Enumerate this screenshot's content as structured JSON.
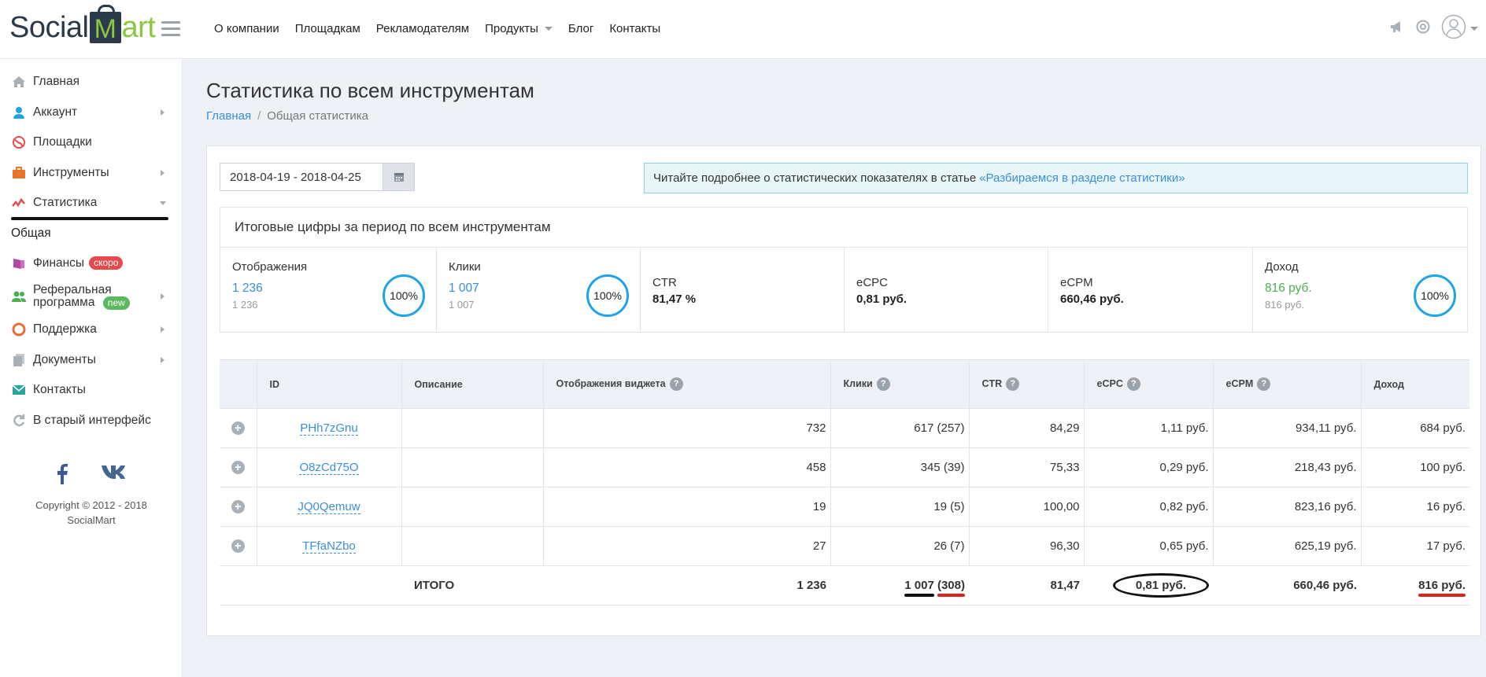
{
  "logo": {
    "part1": "Social",
    "bag": "M",
    "part2": "art"
  },
  "topnav": {
    "about": "О компании",
    "platforms": "Площадкам",
    "advertisers": "Рекламодателям",
    "products": "Продукты",
    "blog": "Блог",
    "contacts": "Контакты"
  },
  "sidebar": {
    "items": [
      {
        "label": "Главная"
      },
      {
        "label": "Аккаунт"
      },
      {
        "label": "Площадки"
      },
      {
        "label": "Инструменты"
      },
      {
        "label": "Статистика"
      },
      {
        "label": "Общая"
      },
      {
        "label": "Финансы",
        "badge": "скоро"
      },
      {
        "label": "Реферальная",
        "label2": "программа",
        "badge": "new"
      },
      {
        "label": "Поддержка"
      },
      {
        "label": "Документы"
      },
      {
        "label": "Контакты"
      },
      {
        "label": "В старый интерфейс"
      }
    ],
    "copyright1": "Copyright © 2012 - 2018",
    "copyright2": "SocialMart"
  },
  "page": {
    "title": "Статистика по всем инструментам",
    "crumb_home": "Главная",
    "crumb_sep": "/",
    "crumb_current": "Общая статистика"
  },
  "filter": {
    "date_range": "2018-04-19 - 2018-04-25"
  },
  "info": {
    "text": "Читайте подробнее о статистических показателях в статье",
    "link": "«Разбираемся в разделе статистики»"
  },
  "summary": {
    "title": "Итоговые цифры за период по всем инструментам",
    "impressions": {
      "label": "Отображения",
      "value": "1 236",
      "sub": "1 236",
      "percent": "100%"
    },
    "clicks": {
      "label": "Клики",
      "value": "1 007",
      "sub": "1 007",
      "percent": "100%"
    },
    "ctr": {
      "label": "CTR",
      "value": "81,47 %"
    },
    "ecpc": {
      "label": "eCPC",
      "value": "0,81 руб."
    },
    "ecpm": {
      "label": "eCPM",
      "value": "660,46 руб."
    },
    "income": {
      "label": "Доход",
      "value": "816 руб.",
      "sub": "816 руб.",
      "percent": "100%"
    }
  },
  "table": {
    "headers": {
      "id": "ID",
      "desc": "Описание",
      "impr": "Отображения виджета",
      "clicks": "Клики",
      "ctr": "CTR",
      "ecpc": "eCPC",
      "ecpm": "eCPM",
      "income": "Доход"
    },
    "rows": [
      {
        "id": "PHh7zGnu",
        "desc": "",
        "impr": "732",
        "clicks": "617 (257)",
        "ctr": "84,29",
        "ecpc": "1,11 руб.",
        "ecpm": "934,11 руб.",
        "income": "684 руб."
      },
      {
        "id": "O8zCd75O",
        "desc": "",
        "impr": "458",
        "clicks": "345 (39)",
        "ctr": "75,33",
        "ecpc": "0,29 руб.",
        "ecpm": "218,43 руб.",
        "income": "100 руб."
      },
      {
        "id": "JQ0Qemuw",
        "desc": "",
        "impr": "19",
        "clicks": "19 (5)",
        "ctr": "100,00",
        "ecpc": "0,82 руб.",
        "ecpm": "823,16 руб.",
        "income": "16 руб."
      },
      {
        "id": "TFfaNZbo",
        "desc": "",
        "impr": "27",
        "clicks": "26 (7)",
        "ctr": "96,30",
        "ecpc": "0,65 руб.",
        "ecpm": "625,19 руб.",
        "income": "17 руб."
      }
    ],
    "total": {
      "label": "ИТОГО",
      "impr": "1 236",
      "clicks_a": "1 007",
      "clicks_b": "(308)",
      "ctr": "81,47",
      "ecpc": "0,81 руб.",
      "ecpm": "660,46 руб.",
      "income": "816 руб."
    }
  },
  "icons": {
    "plus": "+",
    "help": "?"
  }
}
